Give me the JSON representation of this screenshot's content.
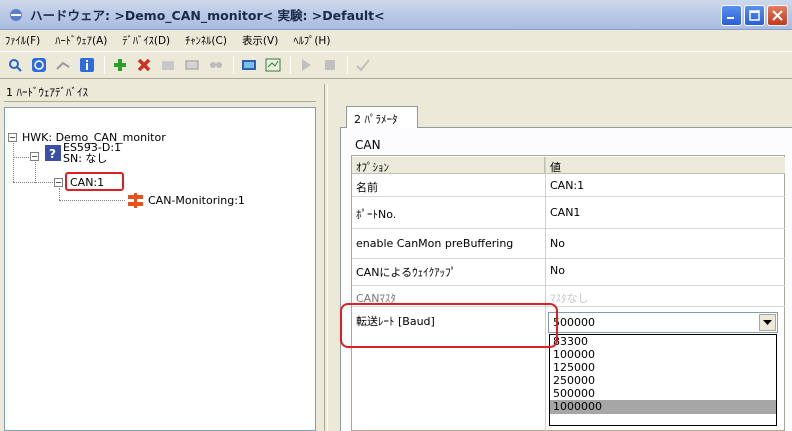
{
  "window": {
    "title": "ハードウェア: >Demo_CAN_monitor<   実験: >Default<",
    "minimize_icon": "minimize-icon",
    "maximize_icon": "maximize-icon",
    "close_icon": "close-icon"
  },
  "menu": [
    "ﾌｧｲﾙ(F)",
    "ﾊｰﾄﾞｳｪｱ(A)",
    "ﾃﾞﾊﾞｲｽ(D)",
    "ﾁｬﾝﾈﾙ(C)",
    "表示(V)",
    "ﾍﾙﾌﾟ(H)"
  ],
  "toolbar_icons": [
    "search-icon",
    "refresh-icon",
    "connect-icon",
    "info-icon",
    "add-icon",
    "delete-icon",
    "module-icon",
    "device-icon",
    "network-icon",
    "monitor-icon",
    "config-icon",
    "play-icon",
    "stop-icon",
    "check-icon"
  ],
  "left_pane": {
    "header": "1 ﾊｰﾄﾞｳｪｱﾃﾞﾊﾞｲｽ",
    "tree": {
      "root": "HWK: Demo_CAN_monitor",
      "device_name": "ES593-D:1",
      "device_sn": "SN: なし",
      "can": "CAN:1",
      "monitoring": "CAN-Monitoring:1"
    }
  },
  "right_pane": {
    "tab": "2 ﾊﾟﾗﾒｰﾀ",
    "section_title": "CAN",
    "columns": [
      "ｵﾌﾟｼｮﾝ",
      "値"
    ],
    "rows": [
      {
        "option": "名前",
        "value": "CAN:1"
      },
      {
        "option": "ﾎﾟｰﾄNo.",
        "value": "CAN1"
      },
      {
        "option": "enable CanMon preBuffering",
        "value": "No"
      },
      {
        "option": "CANによるｳｪｲｸｱｯﾌﾟ",
        "value": "No"
      },
      {
        "option": "CANﾏｽﾀ",
        "value": "ﾏｽﾀなし"
      },
      {
        "option": "転送ﾚｰﾄ [Baud]",
        "value": "500000"
      }
    ],
    "dropdown_options": [
      "83300",
      "100000",
      "125000",
      "250000",
      "500000",
      "1000000"
    ],
    "dropdown_selected": "1000000"
  },
  "colors": {
    "annotation_red": "#e02020",
    "titlebar": "#b9c8e6"
  }
}
